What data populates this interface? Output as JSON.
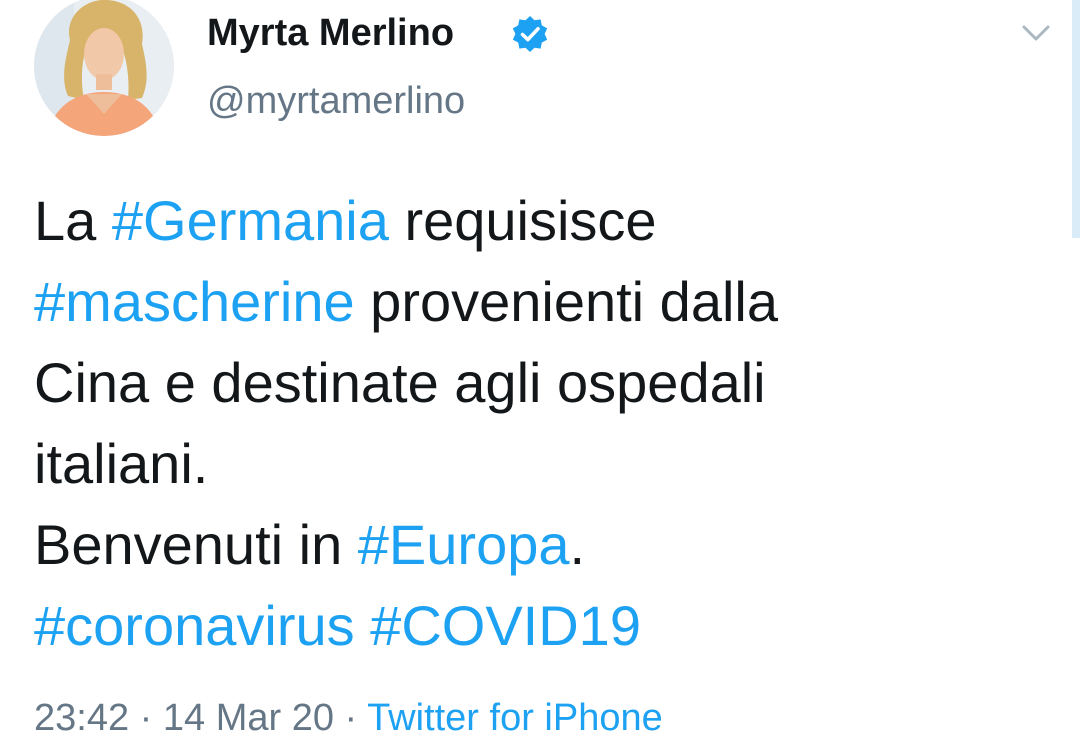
{
  "author": {
    "display_name": "Myrta Merlino",
    "handle": "@myrtamerlino",
    "verified_icon": "verified-badge-icon"
  },
  "menu": {
    "icon": "chevron-down-icon"
  },
  "tweet": {
    "line1": {
      "before": "La ",
      "tag": "#Germania",
      "after": " requisisce"
    },
    "line2": {
      "tag": "#mascherine",
      "after": " provenienti dalla"
    },
    "line3": "Cina e destinate agli ospedali",
    "line4": "italiani.",
    "line5": {
      "before": "Benvenuti in ",
      "tag": "#Europa",
      "after": "."
    },
    "line6": {
      "tag1": "#coronavirus",
      "sep": " ",
      "tag2": "#COVID19"
    }
  },
  "meta": {
    "time": "23:42",
    "dot1": " · ",
    "date": "14 Mar 20",
    "dot2": " · ",
    "source": "Twitter for iPhone"
  },
  "colors": {
    "link": "#1da1f2",
    "secondary": "#657786",
    "primary": "#14171a"
  }
}
